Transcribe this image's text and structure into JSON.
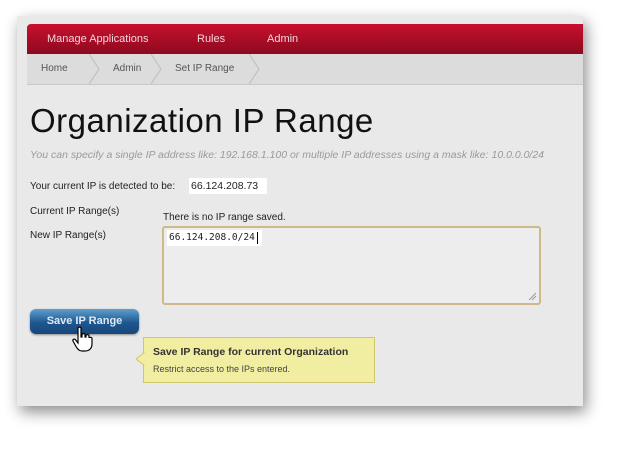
{
  "nav": {
    "items": [
      "Manage Applications",
      "Rules",
      "Admin"
    ]
  },
  "breadcrumb": {
    "items": [
      "Home",
      "Admin",
      "Set IP Range"
    ]
  },
  "page": {
    "title": "Organization IP Range",
    "hint": "You can specify a single IP address like: 192.168.1.100 or multiple IP addresses using a mask like: 10.0.0.0/24"
  },
  "form": {
    "current_ip_label": "Your current IP is detected to be:",
    "current_ip_value": "66.124.208.73",
    "current_ranges_label": "Current IP Range(s)",
    "current_ranges_value": "There is no IP range saved.",
    "new_ranges_label": "New IP Range(s)",
    "new_ranges_value": "66.124.208.0/24"
  },
  "save_button": {
    "label": "Save IP Range"
  },
  "tooltip": {
    "title": "Save IP Range for current Organization",
    "body": "Restrict access to the IPs entered."
  },
  "colors": {
    "nav": "#b00c25",
    "button": "#1e578f",
    "tooltip": "#f1eea2"
  },
  "icons": {
    "cursor": "hand-pointer-icon",
    "resize": "resize-grip-icon"
  }
}
